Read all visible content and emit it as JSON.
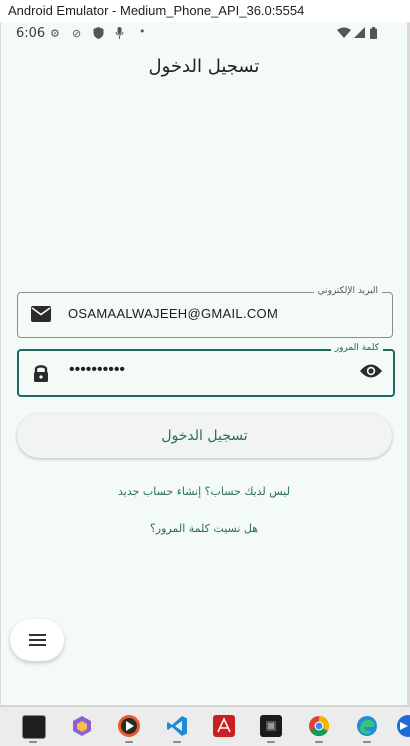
{
  "window": {
    "title": "Android Emulator - Medium_Phone_API_36.0:5554"
  },
  "status_bar": {
    "time": "6:06"
  },
  "app_bar": {
    "title": "تسجيل الدخول"
  },
  "email_field": {
    "label": "البريد الإلكتروني",
    "value": "OSAMAALWAJEEH@GMAIL.COM"
  },
  "password_field": {
    "label": "كلمة المرور",
    "value": "••••••••••"
  },
  "login_button": {
    "label": "تسجيل الدخول"
  },
  "links": {
    "register": "ليس لديك حساب؟ إنشاء حساب جديد",
    "forgot_password": "هل نسيت كلمة المرور؟"
  },
  "colors": {
    "accent": "#1e6b63",
    "background": "#f3faf8",
    "link": "#2d6b62"
  },
  "taskbar": {
    "icons": [
      "terminal-icon",
      "hexagon-app-icon",
      "media-player-icon",
      "vscode-icon",
      "pdf-reader-icon",
      "chip-app-icon",
      "chrome-icon",
      "edge-icon",
      "arrow-app-icon"
    ]
  }
}
